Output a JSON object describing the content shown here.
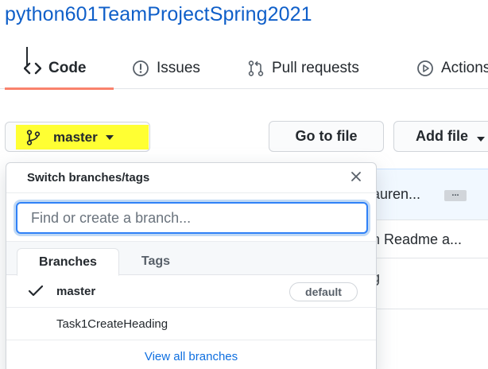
{
  "repo": {
    "name": "python601TeamProjectSpring2021"
  },
  "nav": {
    "tabs": [
      {
        "label": "Code",
        "icon": "code-icon"
      },
      {
        "label": "Issues",
        "icon": "issue-opened-icon"
      },
      {
        "label": "Pull requests",
        "icon": "git-pull-request-icon"
      },
      {
        "label": "Actions",
        "icon": "play-icon"
      }
    ],
    "active_tab": "Code",
    "accent_color": "#f9826c"
  },
  "toolbar": {
    "branch_label": "master",
    "branch_icon": "git-branch-icon",
    "highlight_color": "#ffff33",
    "go_to_file": "Go to file",
    "add_file": "Add file"
  },
  "background_rows": [
    {
      "text": "auren...",
      "ellipsis": "..."
    },
    {
      "text": "h Readme a..."
    },
    {
      "text": "g"
    }
  ],
  "branch_menu": {
    "title": "Switch branches/tags",
    "filter_placeholder": "Find or create a branch...",
    "tabs": [
      "Branches",
      "Tags"
    ],
    "active_tab": "Branches",
    "items": [
      {
        "name": "master",
        "selected": true,
        "badge": "default"
      },
      {
        "name": "Task1CreateHeading",
        "selected": false
      }
    ],
    "view_all": "View all branches",
    "link_color": "#0f6fe0"
  }
}
